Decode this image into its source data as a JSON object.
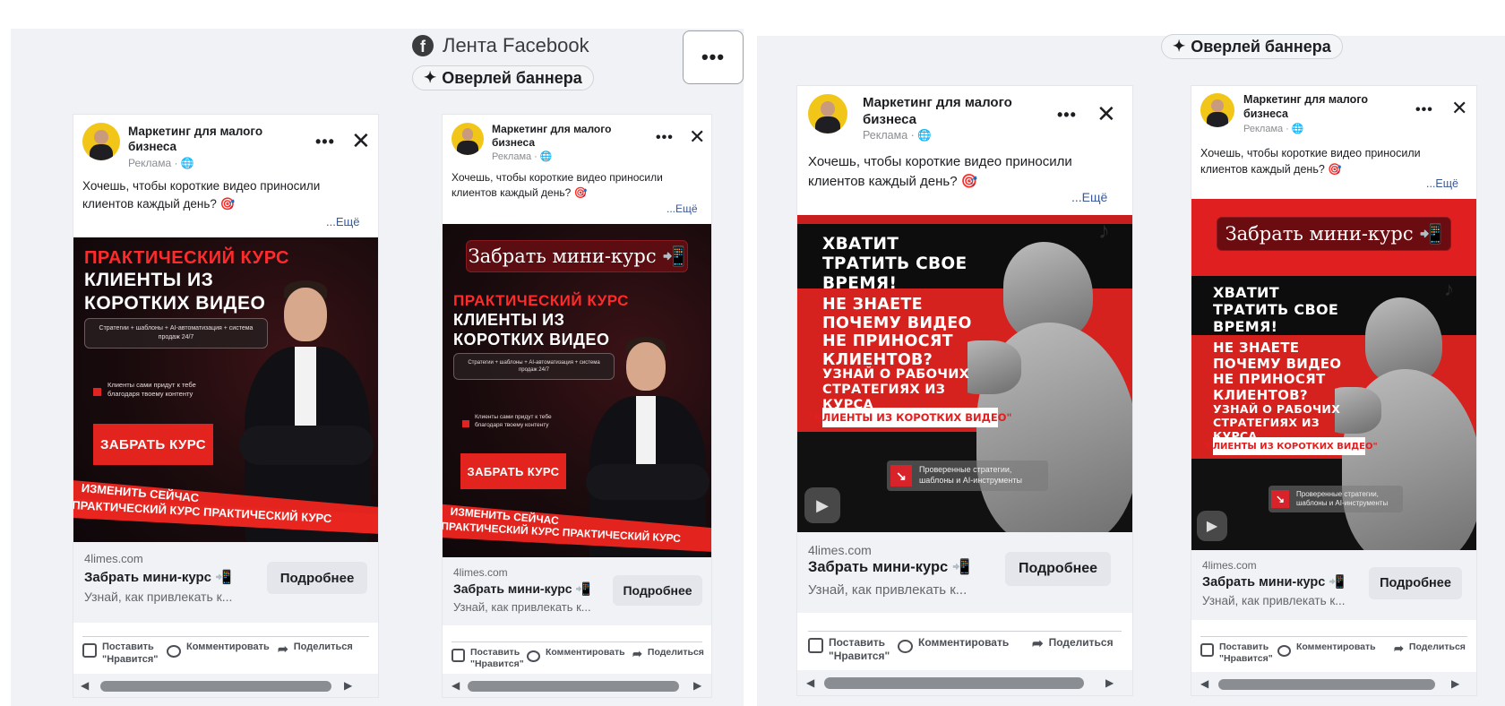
{
  "placement_label": "Лента Facebook",
  "overlay_label": "Оверлей баннера",
  "more_button": "•••",
  "icons": {
    "facebook": "facebook-icon",
    "sparkle": "sparkle-icon",
    "close": "close-icon",
    "more": "more-icon",
    "like": "thumbs-up-icon",
    "comment": "comment-icon",
    "share": "share-icon",
    "phone": "phone-icon"
  },
  "ad": {
    "page_name": "Маркетинг для малого бизнеса",
    "sponsored": "Реклама · 🌐",
    "primary_text": "Хочешь, чтобы короткие видео приносили клиентов каждый день? 🎯",
    "see_more": "...Ещё",
    "domain": "4limes.com",
    "headline": "Забрать мини-курс 📲",
    "description": "Узнай, как привлекать к...",
    "cta": "Подробнее",
    "actions": {
      "like": "Поставить \"Нравится\"",
      "comment": "Комментировать",
      "share": "Поделиться"
    }
  },
  "creative_a": {
    "kicker": "ПРАКТИЧЕСКИЙ КУРС",
    "title_line1": "КЛИЕНТЫ ИЗ",
    "title_line2": "КОРОТКИХ ВИДЕО",
    "tagline": "Стратегии + шаблоны + AI-автоматизация + система продаж 24/7",
    "bullet": "Клиенты сами придут к тебе благодаря твоему контенту",
    "button": "ЗАБРАТЬ КУРС",
    "ribbon1": "ПРАКТИЧЕСКИЙ КУРС ПРАКТИЧЕСКИЙ КУРС",
    "ribbon2": "ИЗМЕНИТЬ СЕЙЧАС",
    "banner": "Забрать мини-курс 📲"
  },
  "creative_b": {
    "headline1": "ХВАТИТ ТРАТИТЬ СВОЕ ВРЕМЯ!",
    "headline2": "НЕ ЗНАЕТЕ ПОЧЕМУ ВИДЕО НЕ ПРИНОСЯТ КЛИЕНТОВ?",
    "headline3": "УЗНАЙ О РАБОЧИХ СТРАТЕГИЯХ ИЗ КУРСА",
    "quote": "\"КЛИЕНТЫ ИЗ КОРОТКИХ ВИДЕО\"",
    "info": "Проверенные стратегии, шаблоны и AI-инструменты",
    "banner": "Забрать мини-курс 📲"
  },
  "colors": {
    "accent_red": "#e3241e",
    "fb_grey": "#f0f2f5",
    "link_blue": "#385898"
  }
}
